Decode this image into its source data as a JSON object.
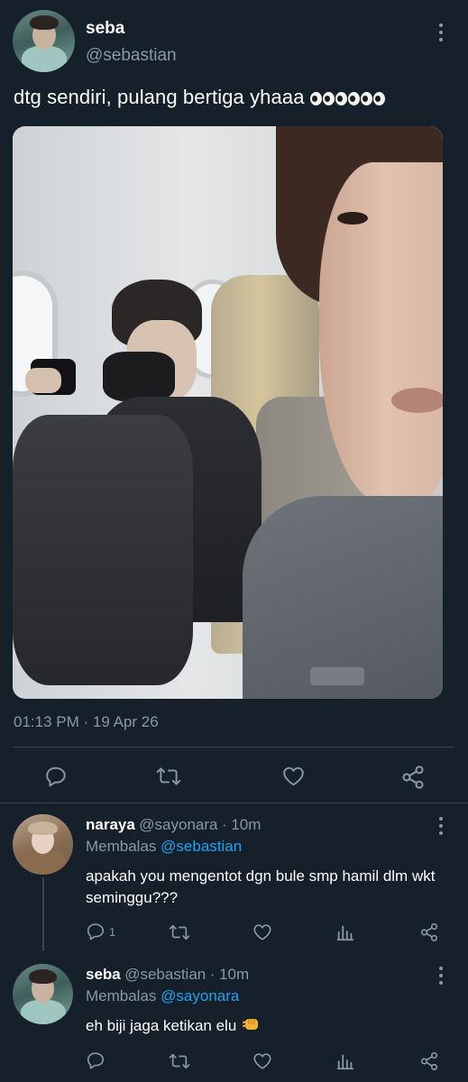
{
  "tweet": {
    "author_name": "seba",
    "author_handle": "@sebastian",
    "text": "dtg sendiri, pulang bertiga yhaaa",
    "emoji": "eyes x6",
    "timestamp": "01:13 PM · 19 Apr 26",
    "actions": [
      {
        "icon": "reply-icon"
      },
      {
        "icon": "retweet-icon"
      },
      {
        "icon": "like-icon"
      },
      {
        "icon": "share-icon"
      }
    ]
  },
  "replies": [
    {
      "author_name": "naraya",
      "author_handle": "@sayonara",
      "time": "· 10m",
      "replying_prefix": "Membalas",
      "replying_to": "@sebastian",
      "text": "apakah you mengentot dgn bule smp hamil dlm wkt seminggu???",
      "reply_count": "1"
    },
    {
      "author_name": "seba",
      "author_handle": "@sebastian",
      "time": "· 10m",
      "replying_prefix": "Membalas",
      "replying_to": "@sayonara",
      "text": "eh biji jaga ketikan elu",
      "emoji": "fist",
      "reply_count": ""
    }
  ],
  "colors": {
    "background": "#15202b",
    "secondary_text": "#8899a6",
    "link": "#1da1f2",
    "divider": "#38444d"
  }
}
